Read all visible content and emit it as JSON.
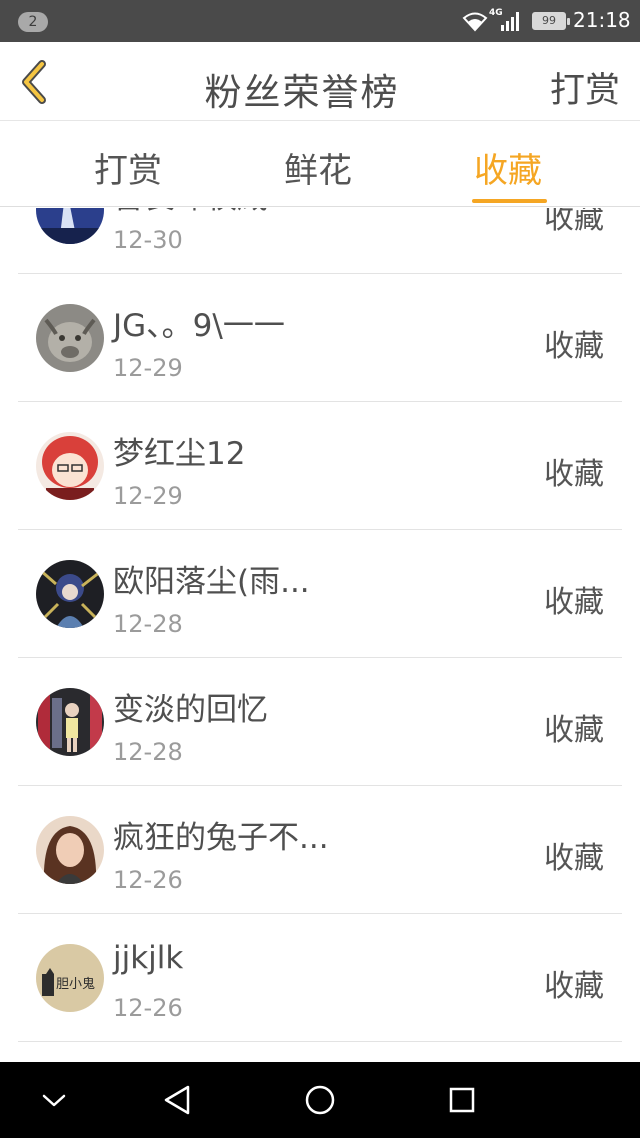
{
  "status_bar": {
    "notification_count": "2",
    "network_label": "4G",
    "battery_level": "99",
    "time": "21:18"
  },
  "header": {
    "title": "粉丝荣誉榜",
    "right_action": "打赏"
  },
  "tabs": [
    {
      "label": "打赏",
      "active": false
    },
    {
      "label": "鲜花",
      "active": false
    },
    {
      "label": "收藏",
      "active": true
    }
  ],
  "colors": {
    "accent": "#f5a623",
    "status_bar": "#4a4a4a",
    "nav_bar": "#000000"
  },
  "list": {
    "items": [
      {
        "name": "善良却权威",
        "date": "12-30",
        "action": "收藏"
      },
      {
        "name": "JG、。9\\一一",
        "date": "12-29",
        "action": "收藏"
      },
      {
        "name": "梦红尘12",
        "date": "12-29",
        "action": "收藏"
      },
      {
        "name": "欧阳落尘(雨...",
        "date": "12-28",
        "action": "收藏"
      },
      {
        "name": "变淡的回忆",
        "date": "12-28",
        "action": "收藏"
      },
      {
        "name": "疯狂的兔子不...",
        "date": "12-26",
        "action": "收藏"
      },
      {
        "name": "jjkjlk",
        "date": "12-26",
        "action": "收藏"
      }
    ]
  },
  "avatar_7_text": "胆小鬼",
  "nav_bar": {
    "icons": [
      "chevron-down-icon",
      "back-triangle-icon",
      "home-circle-icon",
      "recents-square-icon"
    ]
  }
}
